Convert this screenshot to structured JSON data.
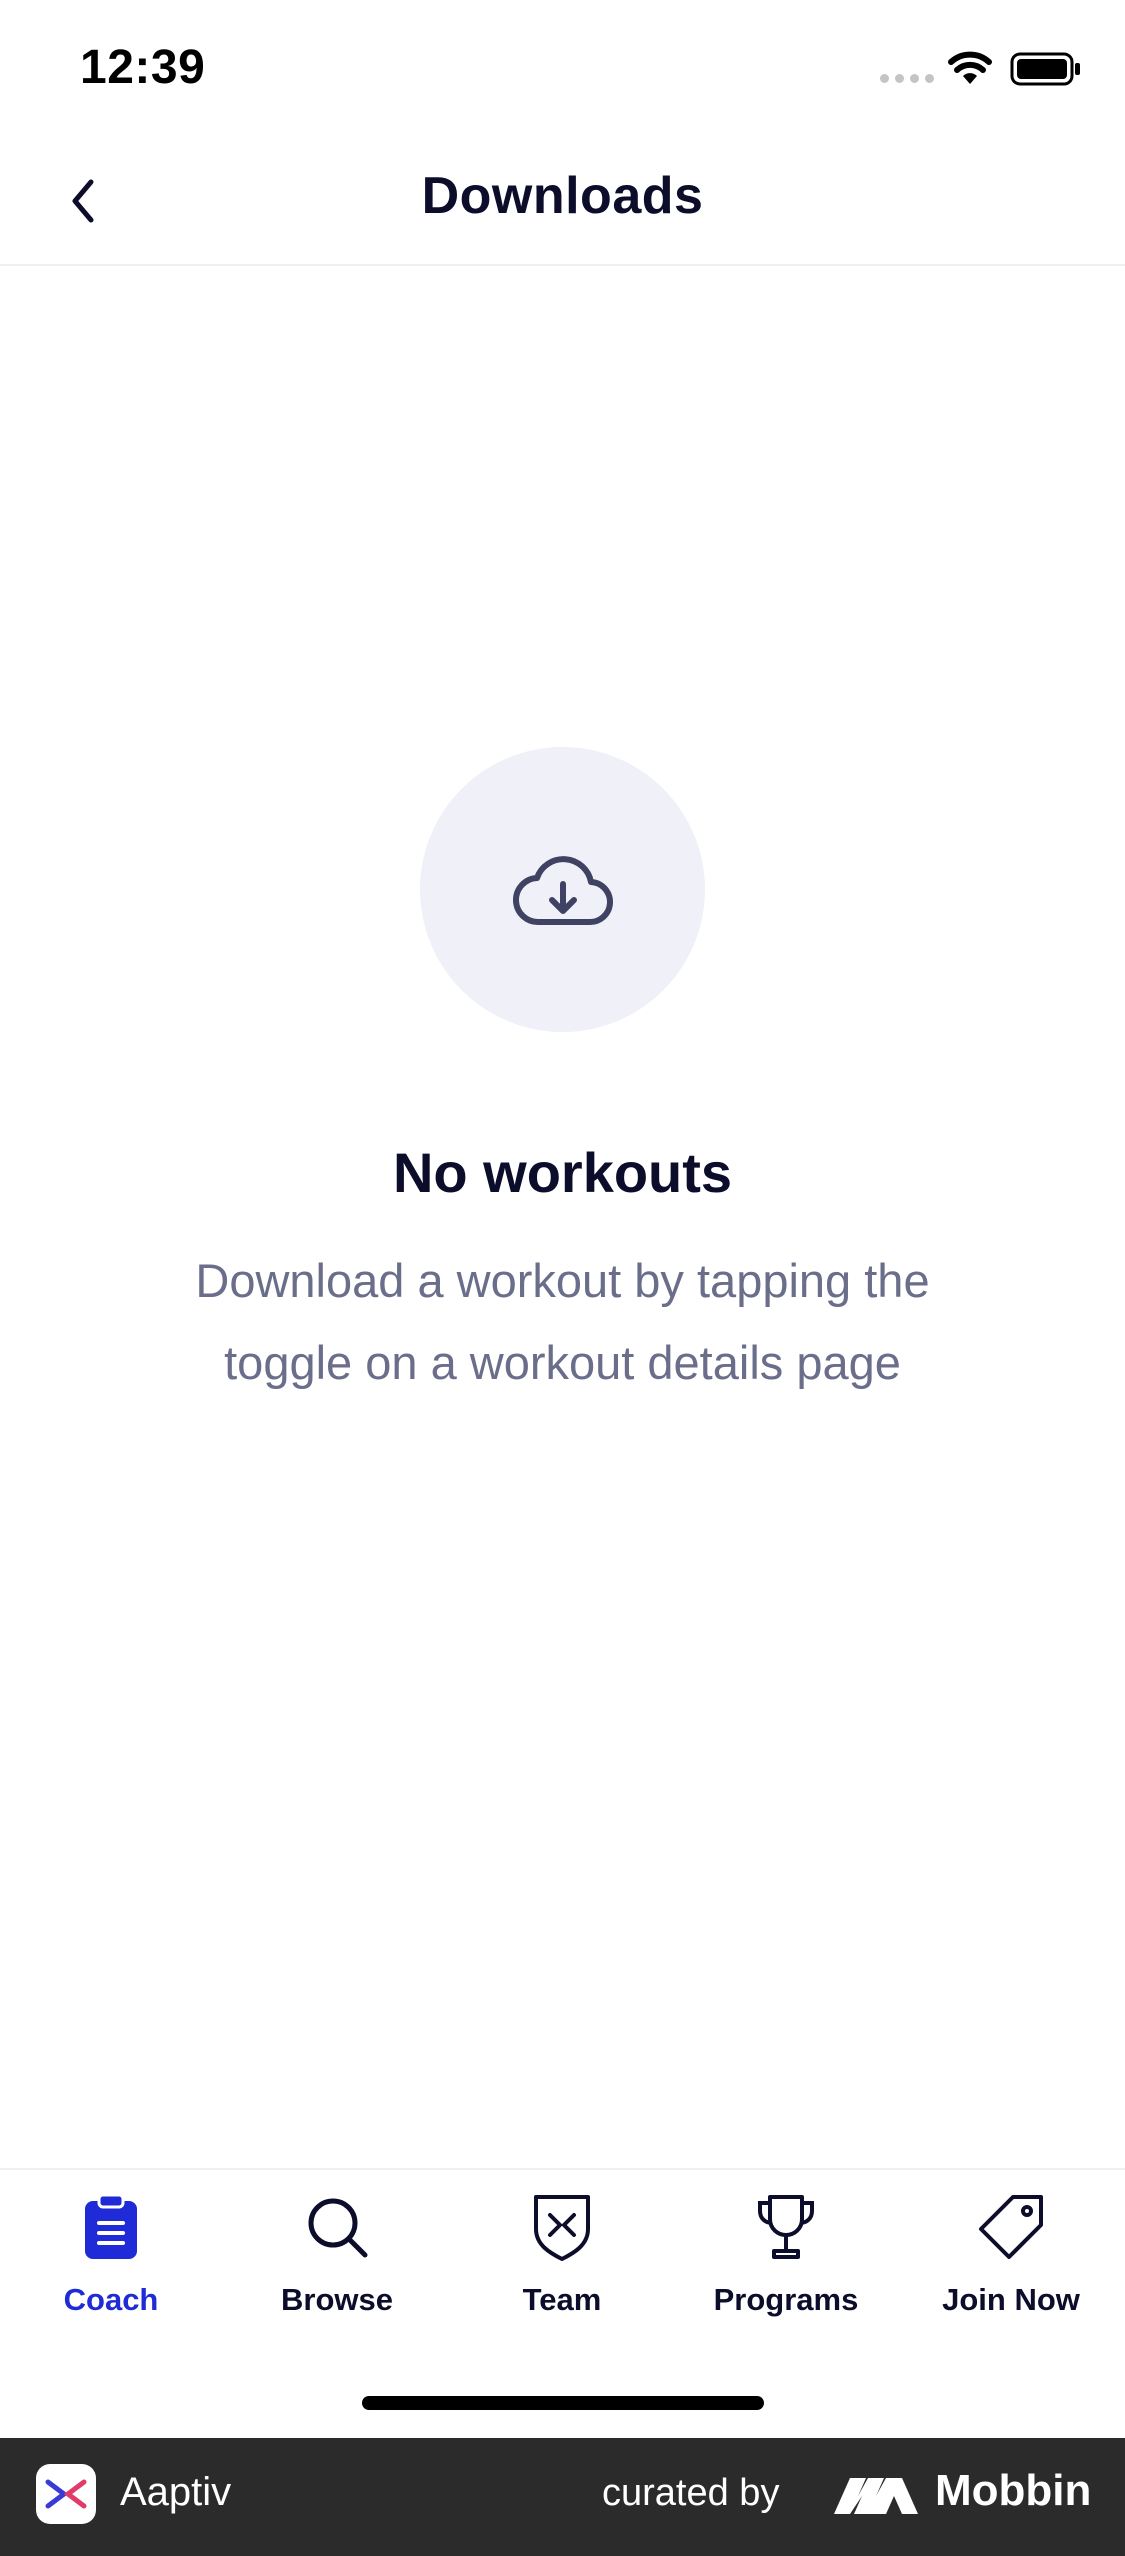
{
  "status_bar": {
    "time": "12:39"
  },
  "header": {
    "title": "Downloads",
    "back_icon": "chevron-left-icon"
  },
  "empty_state": {
    "icon": "cloud-download-icon",
    "title": "No workouts",
    "description": "Download a workout by tapping the toggle on a workout details page"
  },
  "tabbar": {
    "active_color": "#1f2bd6",
    "items": [
      {
        "label": "Coach",
        "icon": "clipboard-icon",
        "active": true
      },
      {
        "label": "Browse",
        "icon": "search-icon",
        "active": false
      },
      {
        "label": "Team",
        "icon": "shield-icon",
        "active": false
      },
      {
        "label": "Programs",
        "icon": "trophy-icon",
        "active": false
      },
      {
        "label": "Join Now",
        "icon": "tag-icon",
        "active": false
      }
    ]
  },
  "footer": {
    "app_name": "Aaptiv",
    "curated_by": "curated by",
    "brand": "Mobbin"
  }
}
